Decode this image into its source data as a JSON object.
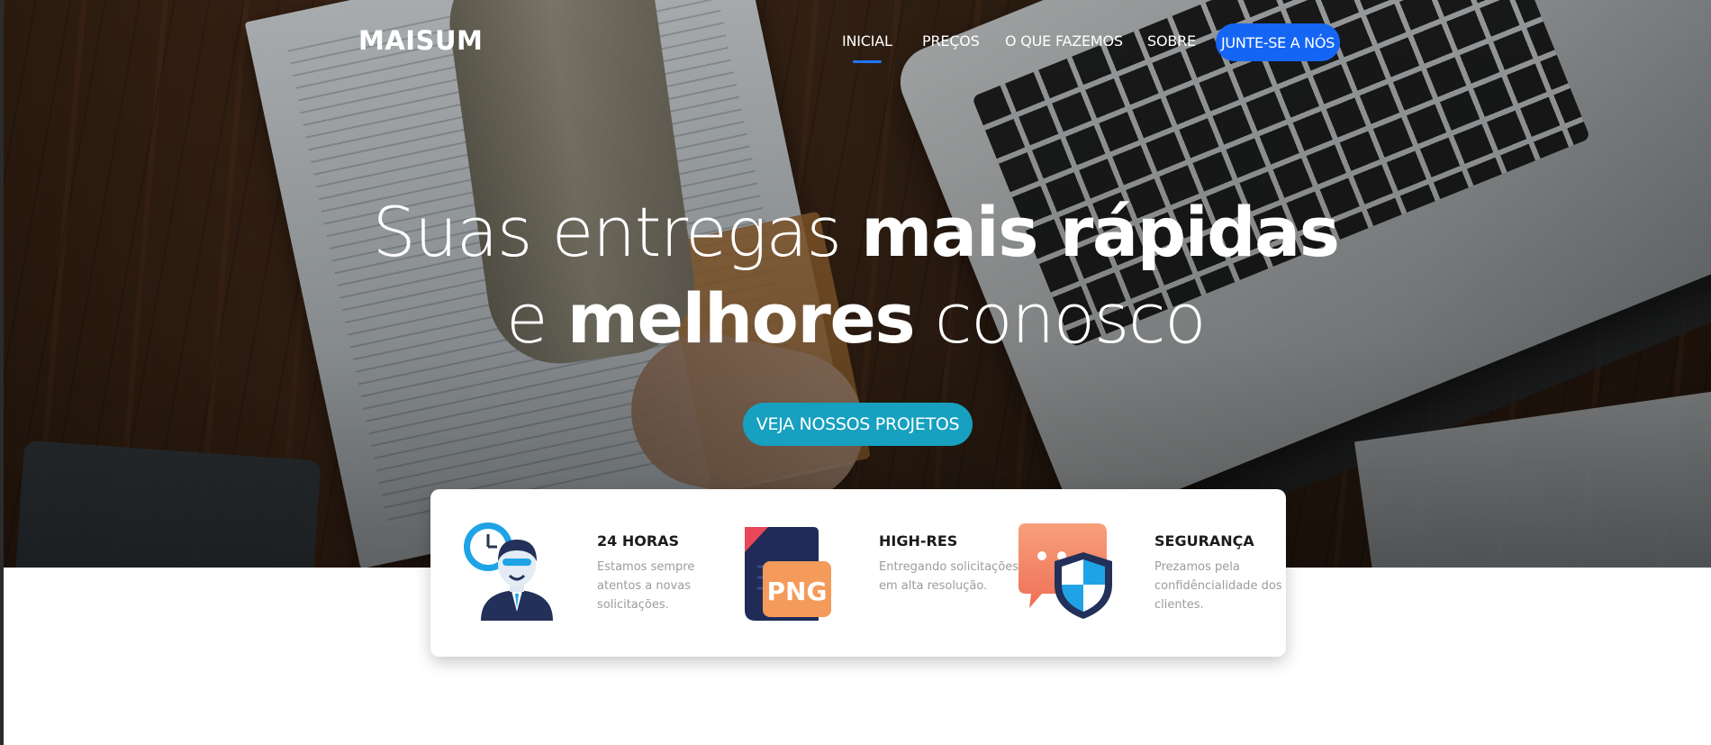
{
  "brand": {
    "logo": "MAISUM"
  },
  "nav": {
    "items": [
      {
        "label": "INICIAL",
        "active": true
      },
      {
        "label": "PREÇOS",
        "active": false
      },
      {
        "label": "O QUE FAZEMOS",
        "active": false
      },
      {
        "label": "SOBRE",
        "active": false
      }
    ],
    "join_label": "JUNTE-SE A NÓS"
  },
  "hero": {
    "line1_light": "Suas entregas ",
    "line1_bold": "mais rápidas",
    "line2_light_a": "e ",
    "line2_bold": "melhores",
    "line2_light_b": " conosco",
    "cta_label": "VEJA NOSSOS PROJETOS"
  },
  "features": [
    {
      "title": "24 HORAS",
      "description": "Estamos sempre atentos a novas solicitações.",
      "icon": "support-agent-clock-icon"
    },
    {
      "title": "HIGH-RES",
      "description": "Entregando solicitações em alta resolução.",
      "icon": "png-file-icon",
      "icon_text": "PNG"
    },
    {
      "title": "SEGURANÇA",
      "description": "Prezamos pela confidêncialidade dos clientes.",
      "icon": "security-shield-chat-icon"
    }
  ],
  "colors": {
    "accent_blue": "#1565f5",
    "cta_teal": "#17a0bf",
    "nav_active_underline": "#1e73ff"
  }
}
